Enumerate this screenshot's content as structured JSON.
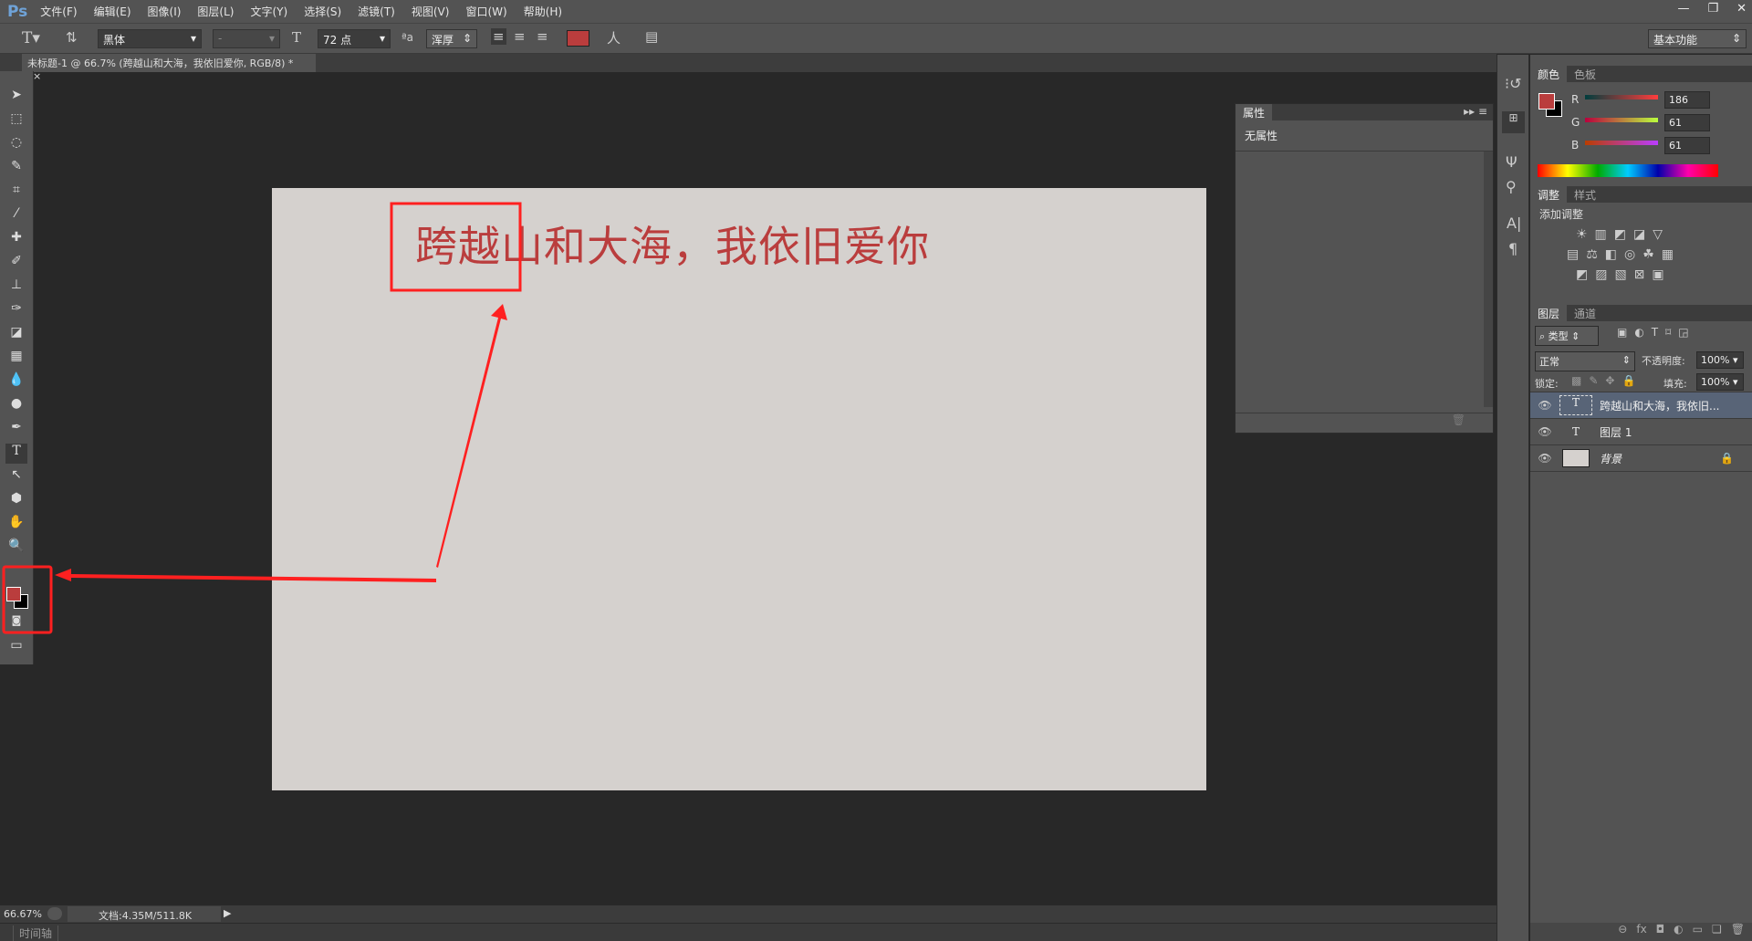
{
  "app": {
    "logo": "Ps",
    "menus": [
      "文件(F)",
      "编辑(E)",
      "图像(I)",
      "图层(L)",
      "文字(Y)",
      "选择(S)",
      "滤镜(T)",
      "视图(V)",
      "窗口(W)",
      "帮助(H)"
    ],
    "window_controls": [
      "—",
      "❐",
      "✕"
    ]
  },
  "options": {
    "font_family": "黑体",
    "font_style": "-",
    "font_size": "72 点",
    "antialias": "浑厚",
    "text_color": "#ba3d3d",
    "workspace": "基本功能"
  },
  "document": {
    "tab_title": "未标题-1 @ 66.7% (跨越山和大海，我依旧爱你, RGB/8) *",
    "close": "×",
    "canvas_text": "跨越山和大海，我依旧爱你",
    "canvas_bg": "#d5d1ce",
    "annotation_color": "#ff2020"
  },
  "properties": {
    "tab": "属性",
    "content": "无属性"
  },
  "color_panel": {
    "tabs": [
      "颜色",
      "色板"
    ],
    "labels": [
      "R",
      "G",
      "B"
    ],
    "values": [
      "186",
      "61",
      "61"
    ],
    "foreground": "#ba3d3d",
    "background": "#000000"
  },
  "adjust_panel": {
    "tabs": [
      "调整",
      "样式"
    ],
    "title": "添加调整"
  },
  "layers_panel": {
    "tabs": [
      "图层",
      "通道"
    ],
    "filter": "类型",
    "blend": "正常",
    "opacity_label": "不透明度:",
    "opacity": "100%",
    "lock_label": "锁定:",
    "fill_label": "填充:",
    "fill": "100%",
    "layers": [
      {
        "name": "跨越山和大海，我依旧...",
        "type": "T",
        "selected": true
      },
      {
        "name": "图层 1",
        "type": "T",
        "selected": false
      },
      {
        "name": "背景",
        "type": "image",
        "selected": false
      }
    ],
    "footer_icons": [
      "⊖",
      "fx",
      "◘",
      "◐",
      "▭",
      "❏",
      "🗑"
    ]
  },
  "status": {
    "zoom": "66.67%",
    "doc": "文档:4.35M/511.8K"
  },
  "timeline": {
    "label": "时间轴"
  }
}
